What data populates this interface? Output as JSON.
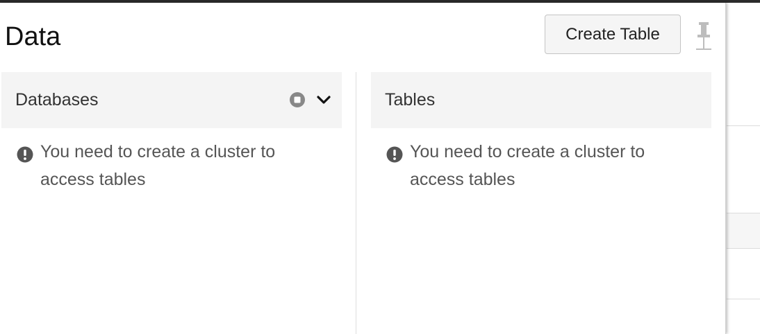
{
  "header": {
    "title": "Data",
    "create_table_label": "Create Table"
  },
  "icons": {
    "pin": "pin-icon",
    "stop": "stop-circle-icon",
    "chevron": "chevron-down-icon",
    "warning": "exclamation-circle-icon"
  },
  "databases": {
    "label": "Databases",
    "message": "You need to create a cluster to access tables"
  },
  "tables": {
    "label": "Tables",
    "message": "You need to create a cluster to access tables"
  },
  "colors": {
    "header_bg": "#f4f4f4",
    "button_bg": "#f5f5f5",
    "icon_gray": "#888888",
    "top_bar": "#2b2b2b"
  }
}
